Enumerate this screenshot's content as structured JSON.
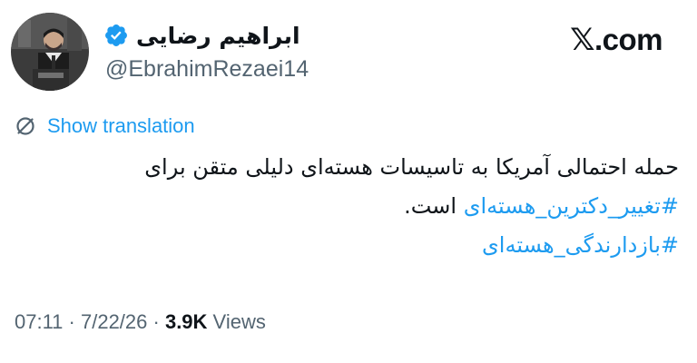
{
  "author": {
    "display_name": "ابراهیم رضایی",
    "handle": "@EbrahimRezaei14",
    "verified": true
  },
  "brand": {
    "x_glyph": "𝕏",
    "label": ".com"
  },
  "translation": {
    "label": "Show translation",
    "icon": "translate-icon"
  },
  "tweet": {
    "line1": "حمله احتمالی آمریکا به تاسیسات هسته‌ای دلیلی متقن برای",
    "hashtag1": "#تغییر_دکترین_هسته‌ای",
    "line2_tail": " است.",
    "hashtag2": "#بازدارندگی_هسته‌ای"
  },
  "meta": {
    "time": "07:11",
    "sep1": " · ",
    "date": "7/22/26",
    "sep2": " · ",
    "views_count": "3.9K",
    "views_label": " Views"
  },
  "colors": {
    "link": "#1d9bf0",
    "text": "#0f1419",
    "muted": "#536471",
    "verified_badge": "#1d9bf0"
  }
}
